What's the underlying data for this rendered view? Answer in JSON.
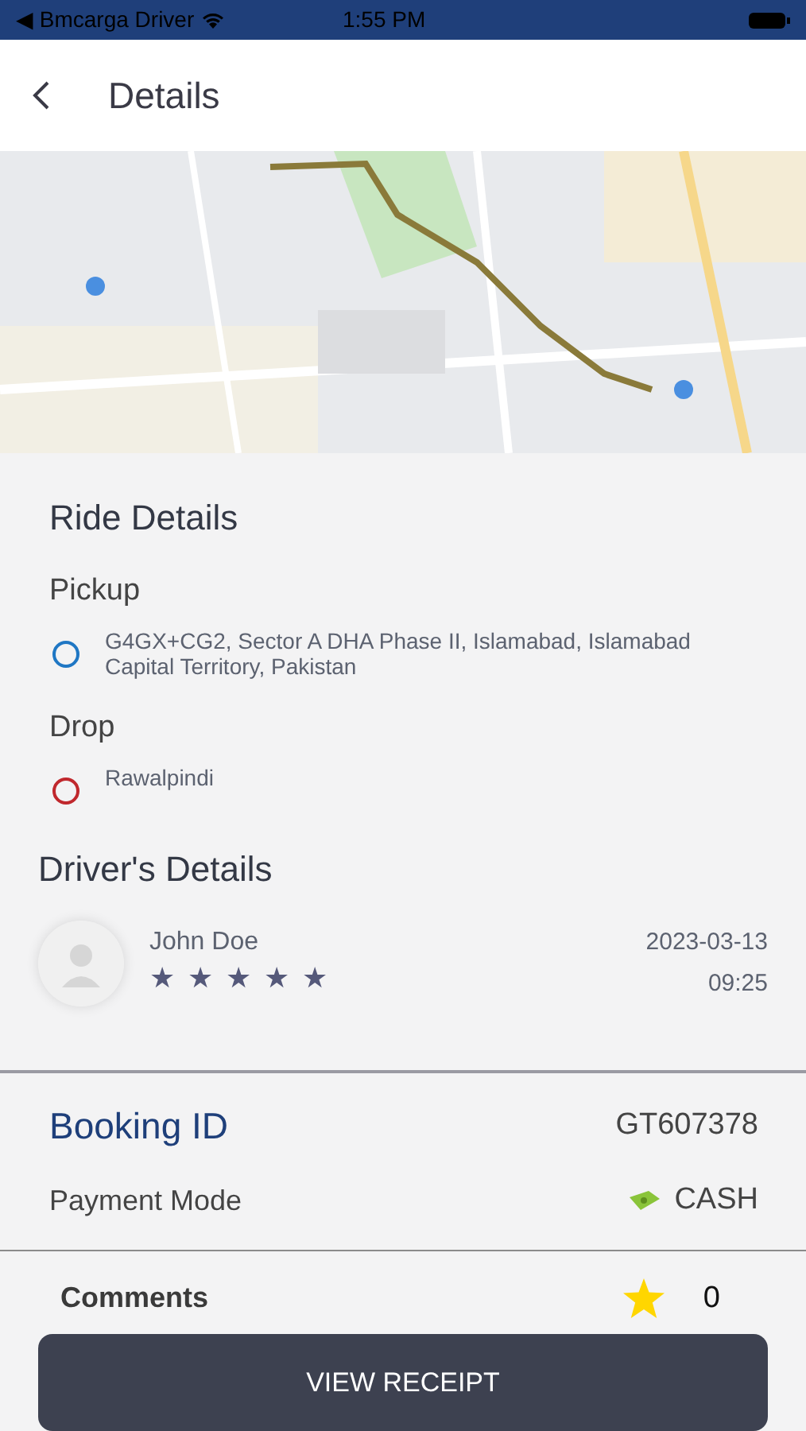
{
  "status_bar": {
    "back_app": "◀ Bmcarga Driver",
    "time": "1:55 PM"
  },
  "header": {
    "title": "Details"
  },
  "ride_details": {
    "title": "Ride Details",
    "stops": [
      {
        "label": "Pickup",
        "address": "G4GX+CG2, Sector A DHA Phase II, Islamabad, Islamabad Capital Territory, Pakistan",
        "color": "#1f77c4"
      },
      {
        "label": "Drop",
        "address": "Rawalpindi",
        "color": "#c0282d"
      }
    ]
  },
  "driver": {
    "title": "Driver's Details",
    "name": "John Doe",
    "stars": 5,
    "date": "2023-03-13",
    "time": "09:25"
  },
  "booking": {
    "label": "Booking ID",
    "value": "GT607378"
  },
  "payment": {
    "label": "Payment Mode",
    "value": "CASH"
  },
  "comments": {
    "label": "Comments",
    "count": "0"
  },
  "button": "VIEW RECEIPT"
}
